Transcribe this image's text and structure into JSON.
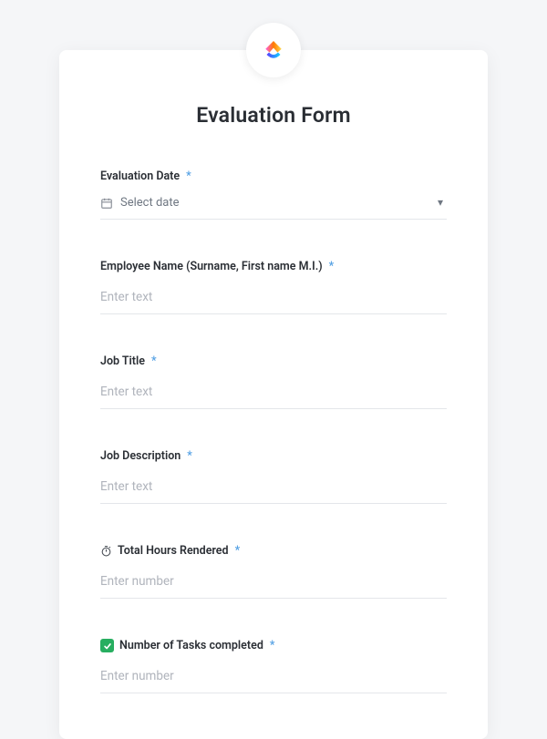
{
  "title": "Evaluation Form",
  "fields": {
    "date": {
      "label": "Evaluation Date",
      "placeholder": "Select date"
    },
    "employee": {
      "label": "Employee Name (Surname, First name M.I.)",
      "placeholder": "Enter text"
    },
    "jobtitle": {
      "label": "Job Title",
      "placeholder": "Enter text"
    },
    "jobdesc": {
      "label": "Job Description",
      "placeholder": "Enter text"
    },
    "hours": {
      "label": "Total Hours Rendered",
      "placeholder": "Enter number"
    },
    "tasks": {
      "label": "Number of Tasks completed",
      "placeholder": "Enter number"
    }
  },
  "required_marker": "*"
}
